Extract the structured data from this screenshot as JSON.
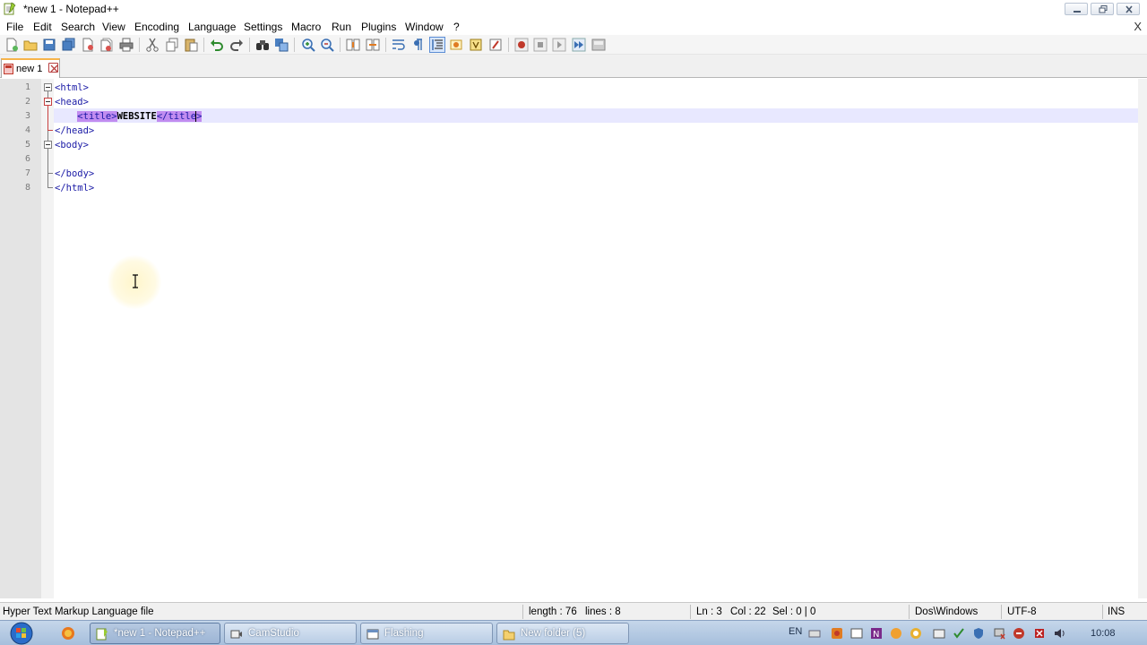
{
  "window": {
    "title": "*new 1 - Notepad++"
  },
  "menu": {
    "items": [
      "File",
      "Edit",
      "Search",
      "View",
      "Encoding",
      "Language",
      "Settings",
      "Macro",
      "Run",
      "Plugins",
      "Window",
      "?"
    ],
    "close_label": "X"
  },
  "toolbar": {
    "buttons": [
      "new-file",
      "open-file",
      "save",
      "save-all",
      "close",
      "close-all",
      "print",
      "cut",
      "copy",
      "paste",
      "undo",
      "redo",
      "find",
      "replace",
      "zoom-in",
      "zoom-out",
      "sync-vertical",
      "sync-horizontal",
      "word-wrap",
      "show-all-characters",
      "indent-guide",
      "user-defined-language",
      "doc-map",
      "function-list",
      "record-macro",
      "stop-recording",
      "playback-macro",
      "run-macro-multiple",
      "save-macro"
    ],
    "active_button": "indent-guide"
  },
  "tabs": [
    {
      "label": "new 1",
      "modified": true
    }
  ],
  "editor": {
    "line_numbers": [
      "1",
      "2",
      "3",
      "4",
      "5",
      "6",
      "7",
      "8"
    ],
    "lines": [
      "<html>",
      "<head>",
      "    <title>WEBSITE</title>",
      "</head>",
      "<body>",
      "",
      "</body>",
      "</html>"
    ],
    "line3": {
      "indent": "    ",
      "open_tag": "<title>",
      "text": "WEBSITE",
      "close_tag": "</title>"
    },
    "current_line": 3
  },
  "status": {
    "file_type": "Hyper Text Markup Language file",
    "length": "length : 76",
    "lines": "lines : 8",
    "ln": "Ln : 3",
    "col": "Col : 22",
    "sel": "Sel : 0 | 0",
    "eol": "Dos\\Windows",
    "encoding": "UTF-8",
    "mode": "INS"
  },
  "taskbar": {
    "buttons": [
      {
        "label": "*new 1 - Notepad++",
        "icon": "notepad-icon",
        "active": true
      },
      {
        "label": "CamStudio",
        "icon": "camstudio-icon",
        "active": false
      },
      {
        "label": "Flashing",
        "icon": "window-icon",
        "active": false
      },
      {
        "label": "New folder (5)",
        "icon": "folder-icon",
        "active": false
      }
    ],
    "tray": {
      "language": "EN",
      "time": "10:08",
      "icons": [
        "keyboard-icon",
        "record-icon",
        "window-icon",
        "onenote-icon",
        "orange-app-icon",
        "tray-app-icon",
        "network-check-icon",
        "shield-icon",
        "network-disconnected-icon",
        "antivirus-icon",
        "volume-icon"
      ]
    }
  },
  "colors": {
    "tag_text": "#1a1aa6",
    "selection_highlight": "#c18cf0",
    "current_line_bg": "#e8e8ff",
    "tab_accent": "#f7b44a",
    "gutter_bg": "#e4e4e4"
  }
}
